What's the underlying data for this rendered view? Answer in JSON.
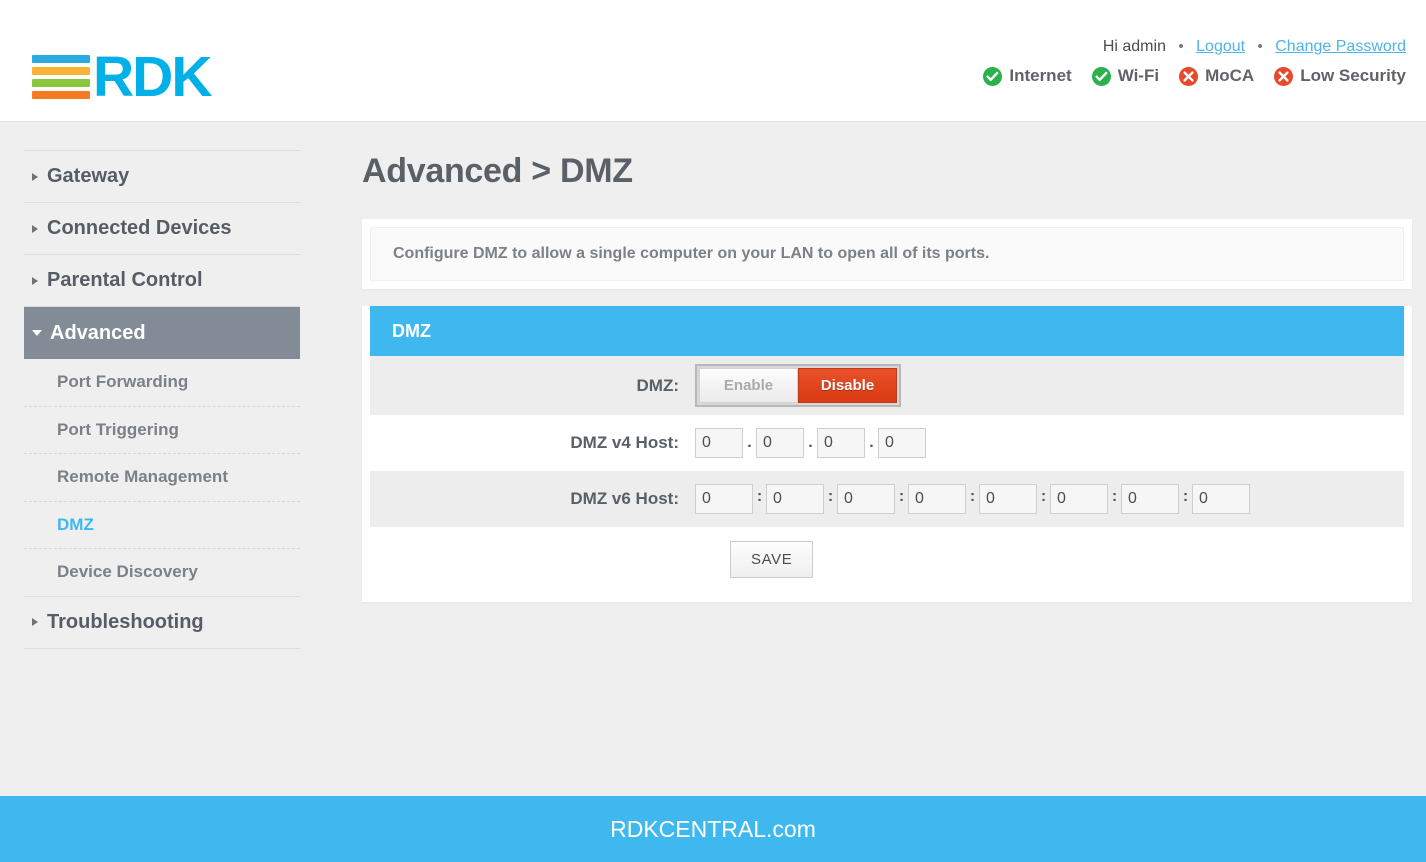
{
  "header": {
    "logo_text": "RDK",
    "logo_bar_colors": [
      "#29abe2",
      "#f9b233",
      "#8cc63f",
      "#f47b20"
    ],
    "logo_text_color": "#00b0e6",
    "greeting": "Hi admin",
    "separator": "•",
    "logout_label": "Logout",
    "change_password_label": "Change Password",
    "link_color": "#4fb3e8",
    "status": [
      {
        "label": "Internet",
        "state": "ok",
        "icon": "check-circle-icon",
        "color": "#2bb24c"
      },
      {
        "label": "Wi-Fi",
        "state": "ok",
        "icon": "check-circle-icon",
        "color": "#2bb24c"
      },
      {
        "label": "MoCA",
        "state": "bad",
        "icon": "x-circle-icon",
        "color": "#e8492b"
      },
      {
        "label": "Low Security",
        "state": "bad",
        "icon": "x-circle-icon",
        "color": "#e8492b"
      }
    ]
  },
  "sidebar": {
    "groups": [
      {
        "label": "Gateway",
        "expanded": false
      },
      {
        "label": "Connected Devices",
        "expanded": false
      },
      {
        "label": "Parental Control",
        "expanded": false
      },
      {
        "label": "Advanced",
        "expanded": true
      },
      {
        "label": "Troubleshooting",
        "expanded": false
      }
    ],
    "advanced_items": [
      {
        "label": "Port Forwarding",
        "current": false
      },
      {
        "label": "Port Triggering",
        "current": false
      },
      {
        "label": "Remote Management",
        "current": false
      },
      {
        "label": "DMZ",
        "current": true
      },
      {
        "label": "Device Discovery",
        "current": false
      }
    ],
    "active_bg": "#838c96",
    "current_color": "#3fb8ef"
  },
  "main": {
    "page_title": "Advanced > DMZ",
    "description": "Configure DMZ to allow a single computer on your LAN to open all of its ports.",
    "panel": {
      "title": "DMZ",
      "header_color": "#3fb8ef",
      "dmz_row_label": "DMZ:",
      "enable_label": "Enable",
      "disable_label": "Disable",
      "selected_toggle": "Disable",
      "v4_label": "DMZ v4 Host:",
      "v4_separator": ".",
      "v4_values": [
        "0",
        "0",
        "0",
        "0"
      ],
      "v6_label": "DMZ v6 Host:",
      "v6_separator": ":",
      "v6_values": [
        "0",
        "0",
        "0",
        "0",
        "0",
        "0",
        "0",
        "0"
      ],
      "save_label": "SAVE"
    }
  },
  "footer": {
    "text": "RDKCENTRAL.com",
    "bg_color": "#3fb8ef"
  }
}
